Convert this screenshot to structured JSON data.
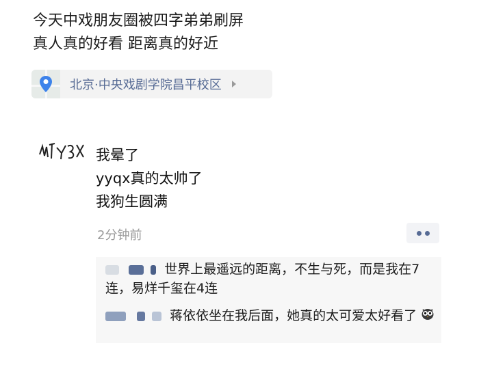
{
  "post": {
    "line1": "今天中戏朋友圈被四字弟弟刷屏",
    "line2": "真人真的好看 距离真的好近"
  },
  "location": {
    "text": "北京·中央戏剧学院昌平校区",
    "icon": "location-pin-icon",
    "arrow_icon": "chevron-right-icon",
    "accent": "#3d83ea"
  },
  "comment": {
    "avatar_icon": "handwritten-avatar-icon",
    "lines": [
      "我晕了",
      "yyqx真的太帅了",
      "我狗生圆满"
    ],
    "time": "2分钟前",
    "more_icon": "more-dots-icon"
  },
  "replies": [
    {
      "text": "世界上最遥远的距离，不生与死，而是我在7连，易烊千玺在4连"
    },
    {
      "text": "蒋依依坐在我后面，她真的太可爱太好看了",
      "emoji": "owl-emoji-icon"
    }
  ],
  "colors": {
    "link": "#576b95",
    "time": "#9a9a9a"
  }
}
